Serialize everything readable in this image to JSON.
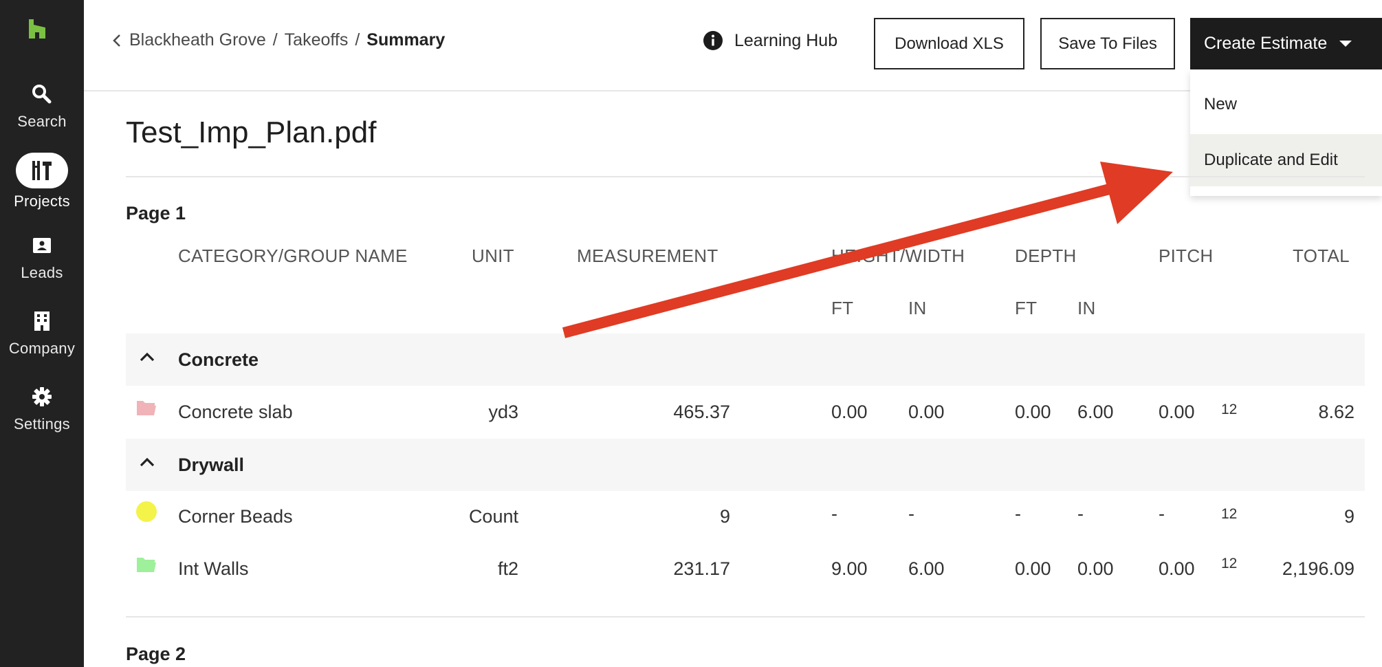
{
  "sidebar": {
    "logo": "houzz-logo",
    "items": [
      {
        "label": "Search",
        "icon": "search-icon"
      },
      {
        "label": "Projects",
        "icon": "projects-icon"
      },
      {
        "label": "Leads",
        "icon": "leads-icon"
      },
      {
        "label": "Company",
        "icon": "company-icon"
      },
      {
        "label": "Settings",
        "icon": "gear-icon"
      }
    ]
  },
  "header": {
    "breadcrumb": {
      "project": "Blackheath Grove",
      "section": "Takeoffs",
      "current": "Summary",
      "separator": "/"
    },
    "learning_hub": "Learning Hub",
    "download_xls": "Download XLS",
    "save_to_files": "Save To Files",
    "create_estimate": "Create Estimate",
    "dropdown": {
      "new": "New",
      "duplicate_and_edit": "Duplicate and Edit"
    }
  },
  "document": {
    "title": "Test_Imp_Plan.pdf"
  },
  "table": {
    "columns": {
      "name": "CATEGORY/GROUP NAME",
      "unit": "UNIT",
      "measurement": "MEASUREMENT",
      "height_width": "HEIGHT/WIDTH",
      "depth": "DEPTH",
      "pitch": "PITCH",
      "total": "TOTAL",
      "ft": "FT",
      "in": "IN"
    },
    "pages": [
      {
        "label": "Page 1",
        "groups": [
          {
            "name": "Concrete",
            "rows": [
              {
                "marker": "folder-icon",
                "color": "#f0b3b8",
                "name": "Concrete slab",
                "unit": "yd3",
                "measurement": "465.37",
                "hw_ft": "0.00",
                "hw_in": "0.00",
                "depth_ft": "0.00",
                "depth_in": "6.00",
                "pitch": "0.00",
                "pitch_sup": "12",
                "total": "8.62"
              }
            ]
          },
          {
            "name": "Drywall",
            "rows": [
              {
                "marker": "dot-icon",
                "color": "#f3f34a",
                "name": "Corner Beads",
                "unit": "Count",
                "measurement": "9",
                "hw_ft": "-",
                "hw_in": "-",
                "depth_ft": "-",
                "depth_in": "-",
                "pitch": "-",
                "pitch_sup": "12",
                "total": "9"
              },
              {
                "marker": "folder-icon",
                "color": "#9ef09a",
                "name": "Int Walls",
                "unit": "ft2",
                "measurement": "231.17",
                "hw_ft": "9.00",
                "hw_in": "6.00",
                "depth_ft": "0.00",
                "depth_in": "0.00",
                "pitch": "0.00",
                "pitch_sup": "12",
                "total": "2,196.09"
              }
            ]
          }
        ]
      },
      {
        "label": "Page 2"
      }
    ]
  },
  "annotation": {
    "arrow_color": "#e03b24"
  },
  "colors": {
    "sidebar_bg": "#222222",
    "logo_green": "#7ac142",
    "primary_button": "#1c1c1c",
    "highlight_row": "#efefec"
  }
}
